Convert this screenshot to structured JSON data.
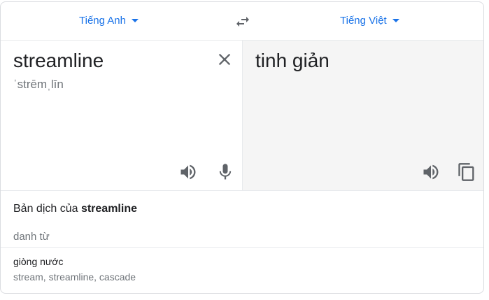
{
  "language_bar": {
    "source_language": "Tiếng Anh",
    "target_language": "Tiếng Việt",
    "swap_icon": "swap-horiz-icon"
  },
  "source_pane": {
    "text": "streamline",
    "phonetic": "ˈstrēmˌlīn",
    "clear_icon": "close-icon",
    "speak_icon": "volume-icon",
    "mic_icon": "mic-icon"
  },
  "target_pane": {
    "text": "tinh giản",
    "speak_icon": "volume-icon",
    "copy_icon": "copy-icon"
  },
  "dictionary": {
    "heading_prefix": "Bản dịch của ",
    "heading_term": "streamline",
    "part_of_speech": "danh từ",
    "entries": [
      {
        "word": "giòng nước",
        "synonyms": "stream, streamline, cascade"
      }
    ]
  },
  "colors": {
    "accent": "#1a73e8",
    "icon": "#5f6368",
    "target_pane_bg": "#f5f5f5"
  }
}
